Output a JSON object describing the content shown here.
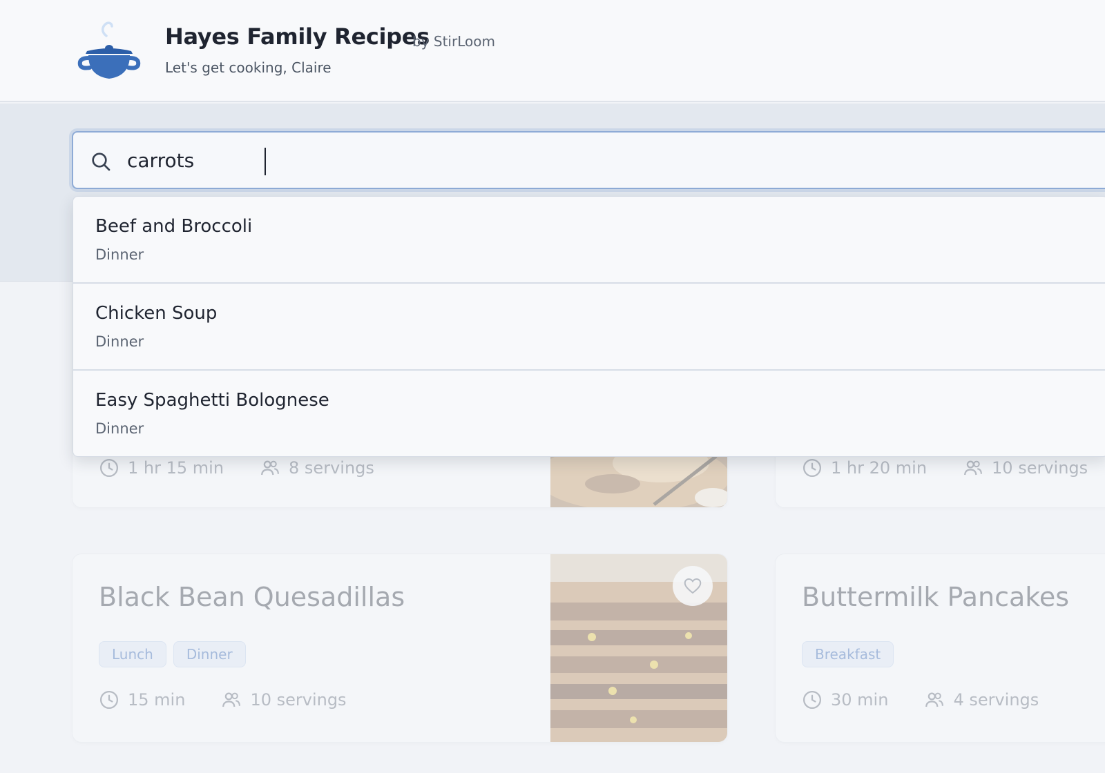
{
  "header": {
    "title": "Hayes Family Recipes",
    "by": "by StirLoom",
    "subtitle": "Let's get cooking, Claire"
  },
  "search": {
    "value": "carrots",
    "icon": "search-icon"
  },
  "suggestions": [
    {
      "name": "Beef and Broccoli",
      "category": "Dinner"
    },
    {
      "name": "Chicken Soup",
      "category": "Dinner"
    },
    {
      "name": "Easy Spaghetti Bolognese",
      "category": "Dinner"
    }
  ],
  "cards": [
    {
      "title": "",
      "tags": [],
      "time": "1 hr 15 min",
      "servings": "8 servings"
    },
    {
      "title": "",
      "tags": [],
      "time": "1 hr 20 min",
      "servings": "10 servings"
    },
    {
      "title": "Black Bean Quesadillas",
      "tags": [
        "Lunch",
        "Dinner"
      ],
      "time": "15 min",
      "servings": "10 servings"
    },
    {
      "title": "Buttermilk Pancakes",
      "tags": [
        "Breakfast"
      ],
      "time": "30 min",
      "servings": "4 servings"
    }
  ],
  "colors": {
    "accent": "#3b6fba",
    "tag_text": "#2f62b1",
    "tag_bg": "#dde8f6"
  }
}
